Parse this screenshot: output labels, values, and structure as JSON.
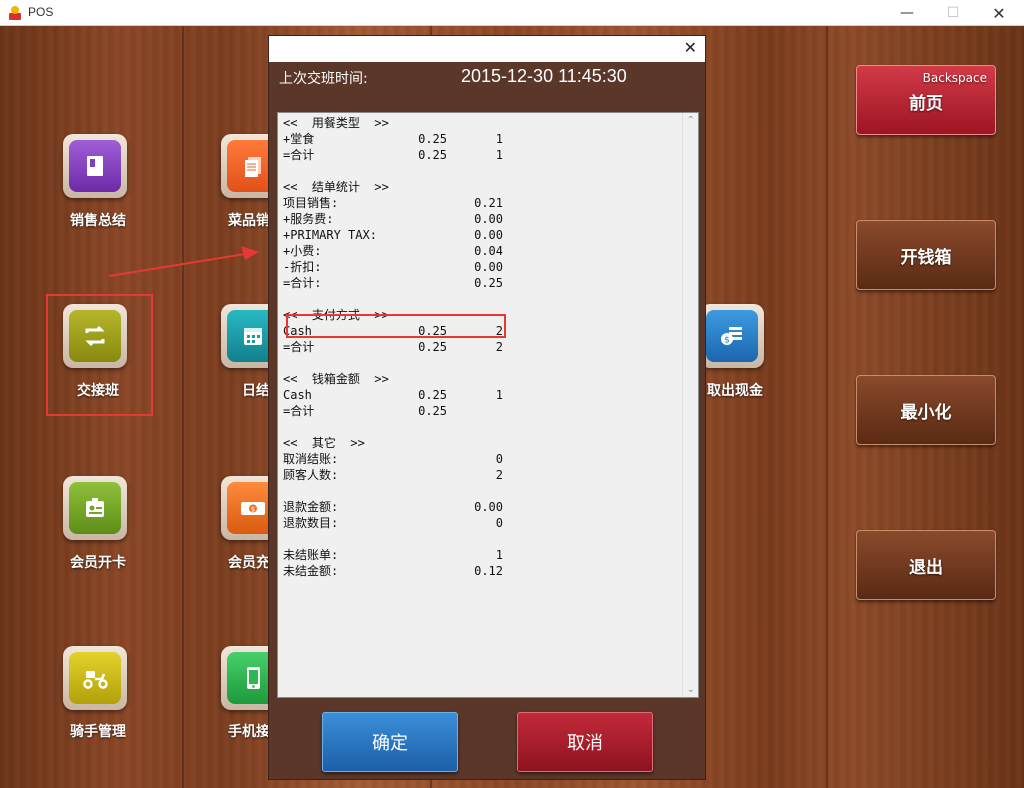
{
  "window": {
    "title": "POS",
    "min_icon": "minimize-icon",
    "max_icon": "maximize-icon",
    "close_icon": "close-icon"
  },
  "tiles": [
    {
      "label": "销售总结",
      "icon": "book-icon",
      "color": "#7d3fbf"
    },
    {
      "label": "菜品销售",
      "icon": "documents-icon",
      "color": "#f0602a"
    },
    {
      "label": "交接班",
      "icon": "swap-icon",
      "color": "#a0a020"
    },
    {
      "label": "日结",
      "icon": "calendar-icon",
      "color": "#1a9aa6"
    },
    {
      "label": "会员开卡",
      "icon": "id-card-icon",
      "color": "#72a72a"
    },
    {
      "label": "会员充值",
      "icon": "money-icon",
      "color": "#ee7426"
    },
    {
      "label": "骑手管理",
      "icon": "scooter-icon",
      "color": "#cdbb1a"
    },
    {
      "label": "手机接单",
      "icon": "phone-icon",
      "color": "#2db852"
    },
    {
      "label": "取出现金",
      "icon": "cash-out-icon",
      "color": "#2980c6"
    }
  ],
  "right_buttons": {
    "prev_label": "前页",
    "prev_hint": "Backspace",
    "cash_drawer_label": "开钱箱",
    "minimize_label": "最小化",
    "exit_label": "退出"
  },
  "dialog": {
    "header_label": "上次交班时间:",
    "header_value": "2015-12-30 11:45:30",
    "ok_label": "确定",
    "cancel_label": "取消",
    "report_lines": [
      {
        "label": "<<  用餐类型  >>",
        "v1": "",
        "v2": ""
      },
      {
        "label": "+堂食",
        "v1": "0.25",
        "v2": "1"
      },
      {
        "label": "=合计",
        "v1": "0.25",
        "v2": "1"
      },
      {
        "label": "",
        "v1": "",
        "v2": ""
      },
      {
        "label": "<<  结单统计  >>",
        "v1": "",
        "v2": ""
      },
      {
        "label": "项目销售:",
        "v1": "",
        "v2": "0.21"
      },
      {
        "label": "+服务费:",
        "v1": "",
        "v2": "0.00"
      },
      {
        "label": "+PRIMARY TAX:",
        "v1": "",
        "v2": "0.00"
      },
      {
        "label": "+小费:",
        "v1": "",
        "v2": "0.04"
      },
      {
        "label": "-折扣:",
        "v1": "",
        "v2": "0.00"
      },
      {
        "label": "=合计:",
        "v1": "",
        "v2": "0.25"
      },
      {
        "label": "",
        "v1": "",
        "v2": ""
      },
      {
        "label": "<<  支付方式  >>",
        "v1": "",
        "v2": ""
      },
      {
        "label": "Cash",
        "v1": "0.25",
        "v2": "2"
      },
      {
        "label": "=合计",
        "v1": "0.25",
        "v2": "2"
      },
      {
        "label": "",
        "v1": "",
        "v2": ""
      },
      {
        "label": "<<  钱箱金额  >>",
        "v1": "",
        "v2": ""
      },
      {
        "label": "Cash",
        "v1": "0.25",
        "v2": "1"
      },
      {
        "label": "=合计",
        "v1": "0.25",
        "v2": ""
      },
      {
        "label": "",
        "v1": "",
        "v2": ""
      },
      {
        "label": "<<  其它  >>",
        "v1": "",
        "v2": ""
      },
      {
        "label": "取消结账:",
        "v1": "",
        "v2": "0"
      },
      {
        "label": "顾客人数:",
        "v1": "",
        "v2": "2"
      },
      {
        "label": "",
        "v1": "",
        "v2": ""
      },
      {
        "label": "退款金额:",
        "v1": "",
        "v2": "0.00"
      },
      {
        "label": "退款数目:",
        "v1": "",
        "v2": "0"
      },
      {
        "label": "",
        "v1": "",
        "v2": ""
      },
      {
        "label": "未结账单:",
        "v1": "",
        "v2": "1"
      },
      {
        "label": "未结金额:",
        "v1": "",
        "v2": "0.12"
      }
    ]
  },
  "annotation_color": "#e53935"
}
